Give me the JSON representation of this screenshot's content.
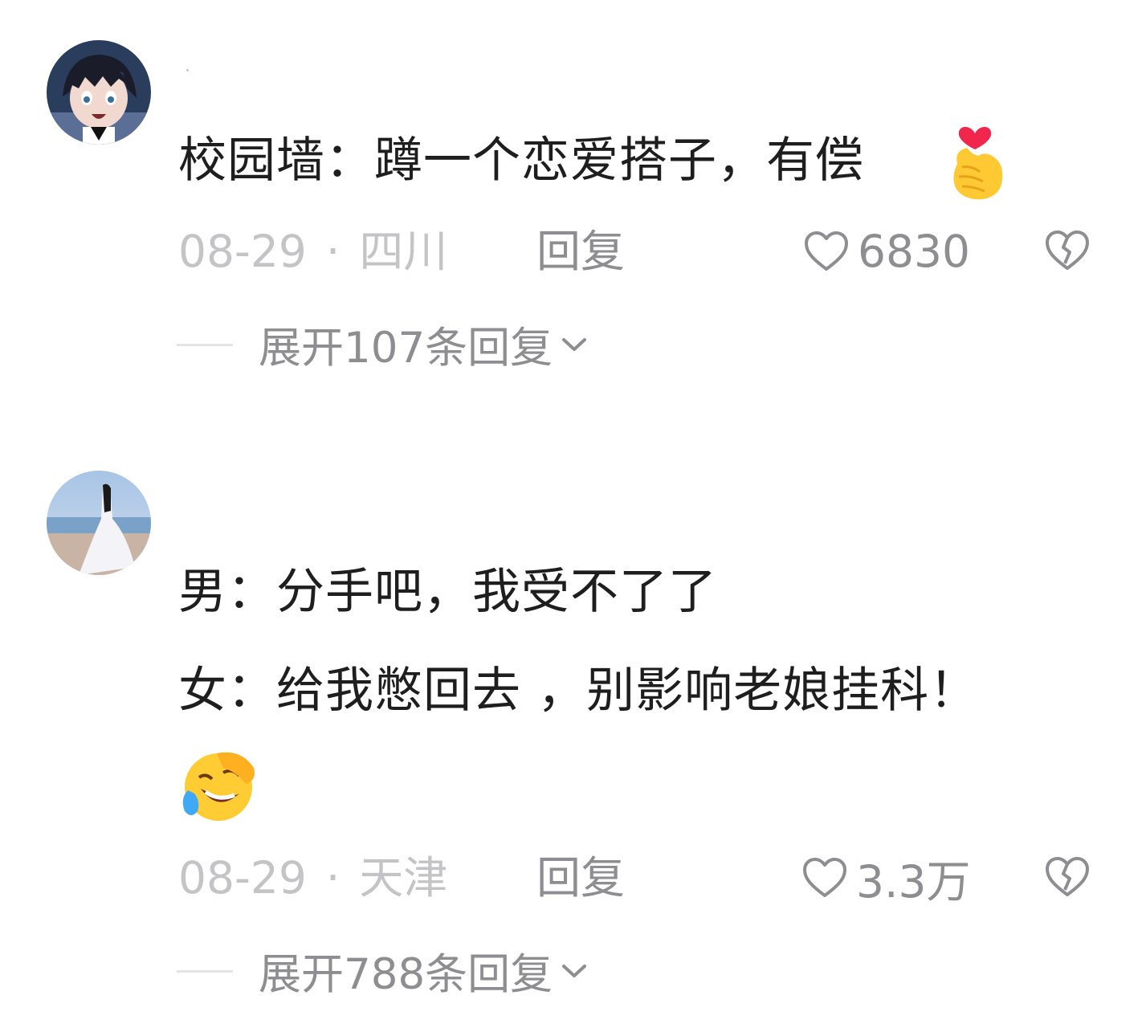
{
  "comments": [
    {
      "lines": [
        "校园墙：蹲一个恋爱搭子，有偿"
      ],
      "emoji": "finger-heart-emoji",
      "date": "08-29",
      "location": "四川",
      "reply_label": "回复",
      "likes": "6830",
      "expand_label": "展开107条回复"
    },
    {
      "lines": [
        "男：分手吧，我受不了了",
        "女：给我憋回去 ，别影响老娘挂科！"
      ],
      "emoji": "rolling-laughing-emoji",
      "date": "08-29",
      "location": "天津",
      "reply_label": "回复",
      "likes": "3.3万",
      "expand_label": "展开788条回复"
    }
  ],
  "separator": "·",
  "colors": {
    "text": "#1e1e1e",
    "meta": "#c4c4c6",
    "secondary": "#8e8e92"
  }
}
